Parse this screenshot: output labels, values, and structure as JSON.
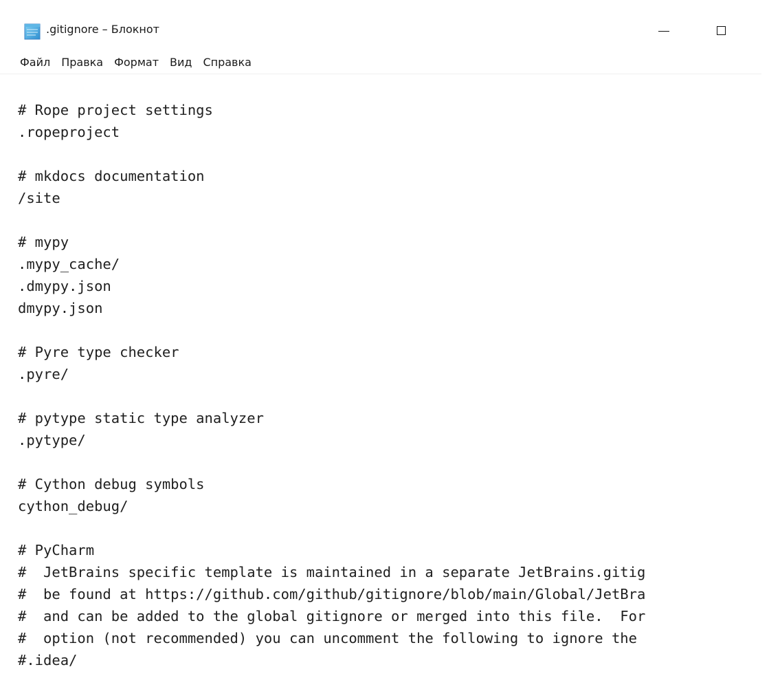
{
  "window": {
    "title": ".gitignore – Блокнот",
    "controls": {
      "minimize": "minimize",
      "maximize": "maximize"
    }
  },
  "menubar": {
    "items": [
      "Файл",
      "Правка",
      "Формат",
      "Вид",
      "Справка"
    ]
  },
  "editor": {
    "lines": [
      "# Rope project settings",
      ".ropeproject",
      "",
      "# mkdocs documentation",
      "/site",
      "",
      "# mypy",
      ".mypy_cache/",
      ".dmypy.json",
      "dmypy.json",
      "",
      "# Pyre type checker",
      ".pyre/",
      "",
      "# pytype static type analyzer",
      ".pytype/",
      "",
      "# Cython debug symbols",
      "cython_debug/",
      "",
      "# PyCharm",
      "#  JetBrains specific template is maintained in a separate JetBrains.gitig",
      "#  be found at https://github.com/github/gitignore/blob/main/Global/JetBra",
      "#  and can be added to the global gitignore or merged into this file.  For",
      "#  option (not recommended) you can uncomment the following to ignore the",
      "#.idea/"
    ]
  },
  "icons": {
    "app": "notepad-icon",
    "minimize": "minimize-icon",
    "maximize": "maximize-icon"
  }
}
